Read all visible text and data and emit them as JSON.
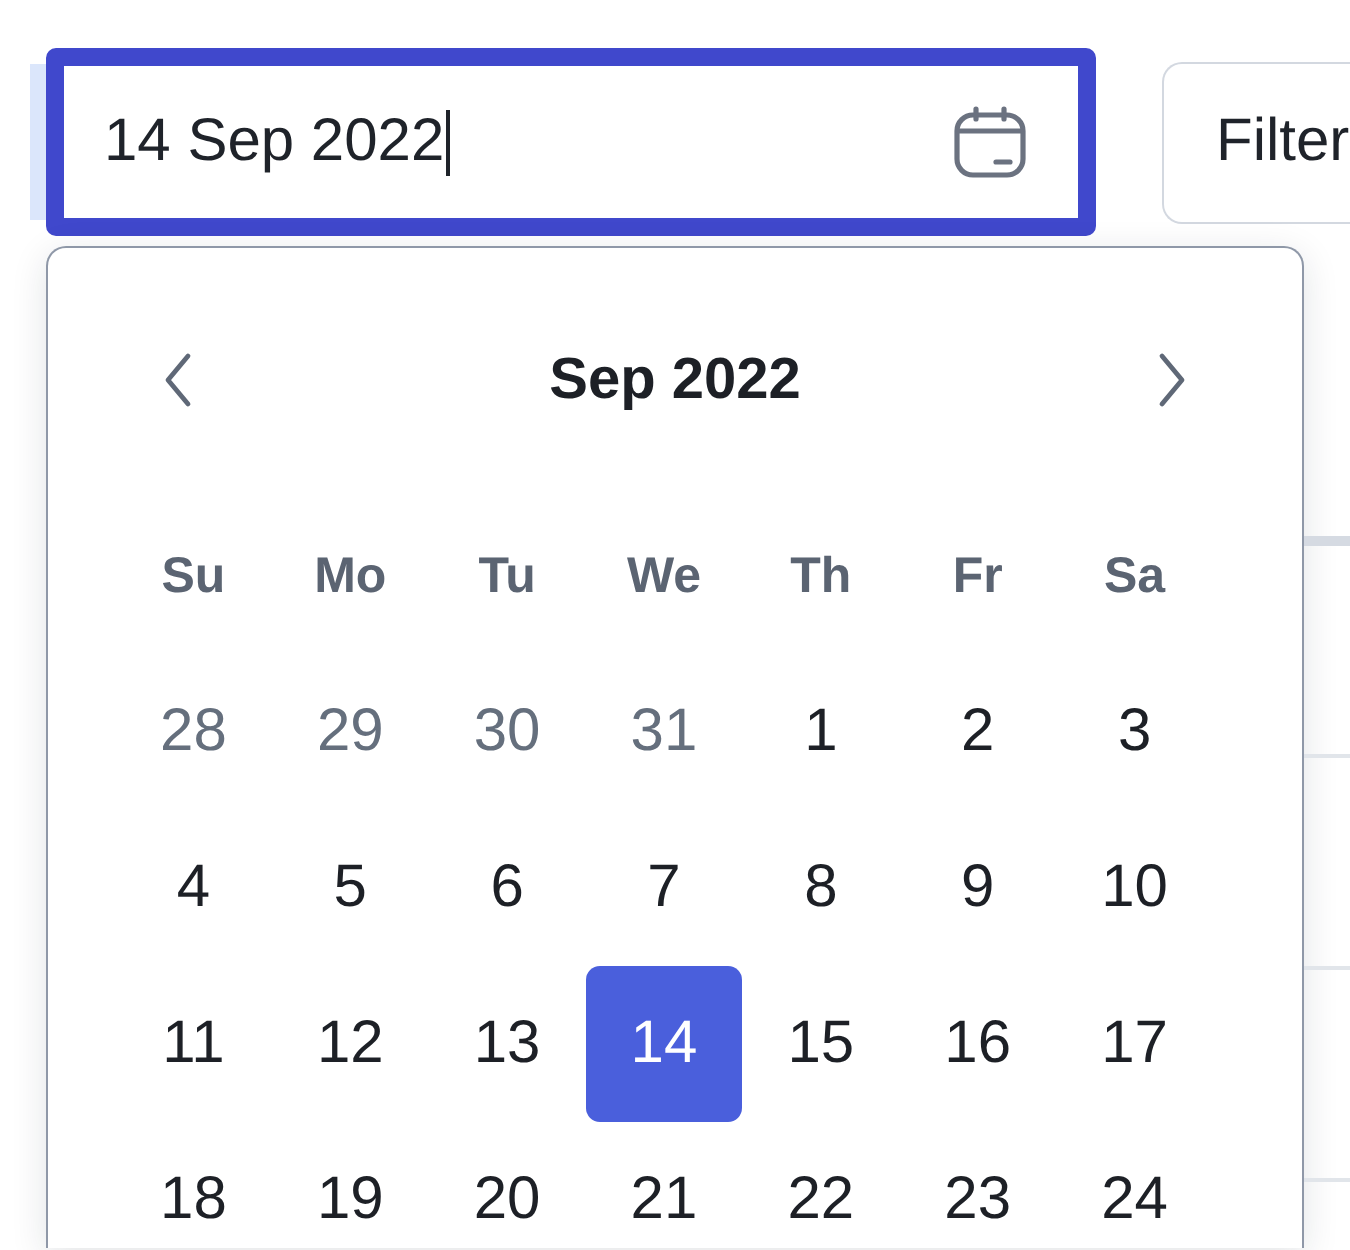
{
  "date_field": {
    "value": "14 Sep 2022",
    "focused": true
  },
  "filter_button": {
    "label": "Filter"
  },
  "calendar": {
    "title": "Sep 2022",
    "weekdays": [
      "Su",
      "Mo",
      "Tu",
      "We",
      "Th",
      "Fr",
      "Sa"
    ],
    "days": [
      {
        "label": "28",
        "outside": true,
        "selected": false
      },
      {
        "label": "29",
        "outside": true,
        "selected": false
      },
      {
        "label": "30",
        "outside": true,
        "selected": false
      },
      {
        "label": "31",
        "outside": true,
        "selected": false
      },
      {
        "label": "1",
        "outside": false,
        "selected": false
      },
      {
        "label": "2",
        "outside": false,
        "selected": false
      },
      {
        "label": "3",
        "outside": false,
        "selected": false
      },
      {
        "label": "4",
        "outside": false,
        "selected": false
      },
      {
        "label": "5",
        "outside": false,
        "selected": false
      },
      {
        "label": "6",
        "outside": false,
        "selected": false
      },
      {
        "label": "7",
        "outside": false,
        "selected": false
      },
      {
        "label": "8",
        "outside": false,
        "selected": false
      },
      {
        "label": "9",
        "outside": false,
        "selected": false
      },
      {
        "label": "10",
        "outside": false,
        "selected": false
      },
      {
        "label": "11",
        "outside": false,
        "selected": false
      },
      {
        "label": "12",
        "outside": false,
        "selected": false
      },
      {
        "label": "13",
        "outside": false,
        "selected": false
      },
      {
        "label": "14",
        "outside": false,
        "selected": true
      },
      {
        "label": "15",
        "outside": false,
        "selected": false
      },
      {
        "label": "16",
        "outside": false,
        "selected": false
      },
      {
        "label": "17",
        "outside": false,
        "selected": false
      },
      {
        "label": "18",
        "outside": false,
        "selected": false
      },
      {
        "label": "19",
        "outside": false,
        "selected": false
      },
      {
        "label": "20",
        "outside": false,
        "selected": false
      },
      {
        "label": "21",
        "outside": false,
        "selected": false
      },
      {
        "label": "22",
        "outside": false,
        "selected": false
      },
      {
        "label": "23",
        "outside": false,
        "selected": false
      },
      {
        "label": "24",
        "outside": false,
        "selected": false
      }
    ]
  }
}
